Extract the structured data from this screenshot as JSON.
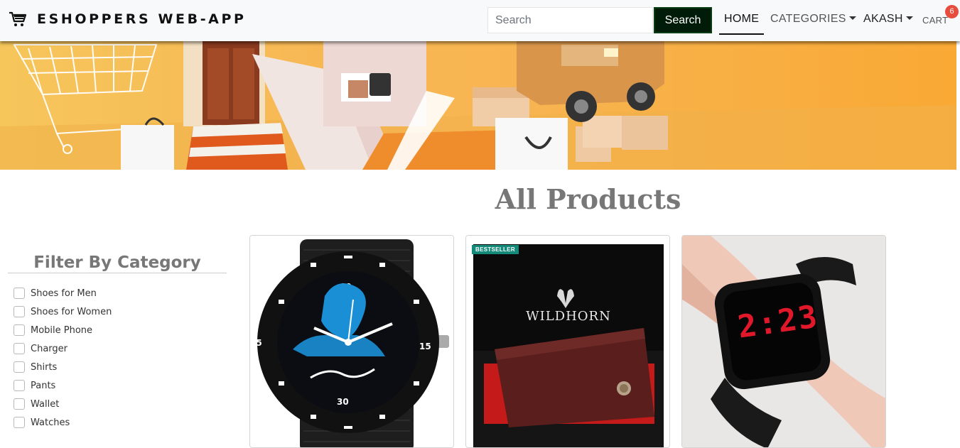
{
  "navbar": {
    "brand": "ESHOPPERS WEB-APP",
    "search_placeholder": "Search",
    "search_button": "Search",
    "links": {
      "home": "HOME",
      "categories": "CATEGORIES",
      "user": "AKASH",
      "cart": "CART"
    },
    "cart_count": "6"
  },
  "heading": "All Products",
  "filter": {
    "title": "Filter By Category",
    "categories": [
      "Shoes for Men",
      "Shoes for Women",
      "Mobile Phone",
      "Charger",
      "Shirts",
      "Pants",
      "Wallet",
      "Watches"
    ]
  },
  "products": [
    {
      "image": "mahadev-analog-watch",
      "badge": ""
    },
    {
      "image": "wildhorn-brown-wallet",
      "badge": "BESTSELLER",
      "brand_print": "WILDHORN"
    },
    {
      "image": "black-led-digital-watch",
      "badge": "",
      "display_time": "2:23"
    }
  ],
  "colors": {
    "navbar_bg": "#f8f9fa",
    "search_button_bg": "#001b07",
    "cart_badge": "#e74c3c",
    "banner_orange": "#f9a934",
    "heading": "#777777",
    "bestseller_badge": "#148a7a"
  }
}
